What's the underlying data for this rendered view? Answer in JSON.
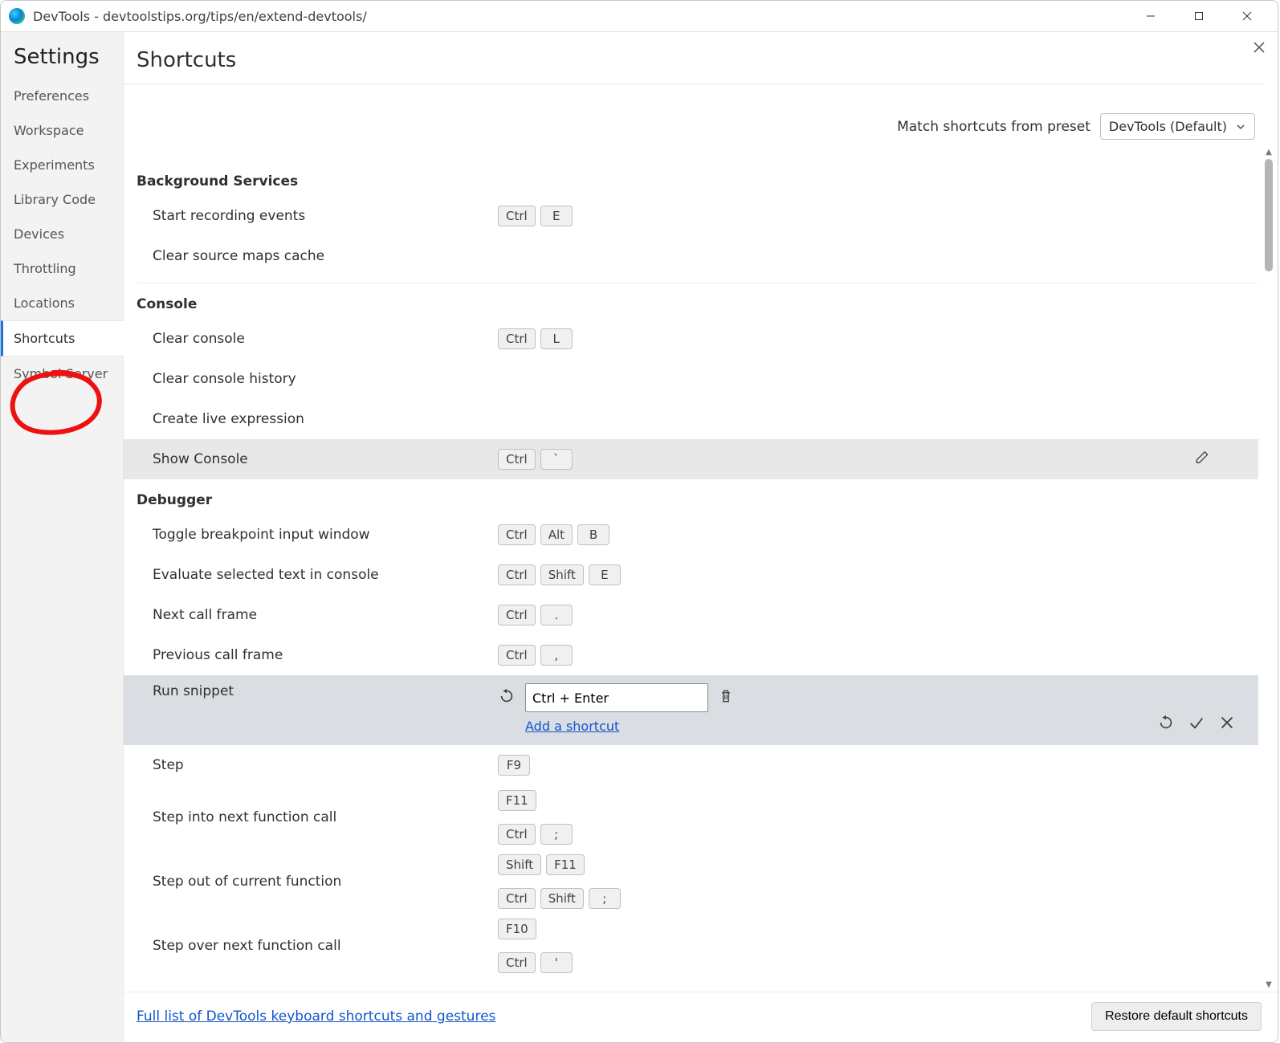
{
  "window": {
    "title": "DevTools - devtoolstips.org/tips/en/extend-devtools/"
  },
  "sidebar": {
    "title": "Settings",
    "items": [
      {
        "label": "Preferences",
        "selected": false
      },
      {
        "label": "Workspace",
        "selected": false
      },
      {
        "label": "Experiments",
        "selected": false
      },
      {
        "label": "Library Code",
        "selected": false
      },
      {
        "label": "Devices",
        "selected": false
      },
      {
        "label": "Throttling",
        "selected": false
      },
      {
        "label": "Locations",
        "selected": false
      },
      {
        "label": "Shortcuts",
        "selected": true
      },
      {
        "label": "Symbol Server",
        "selected": false
      }
    ]
  },
  "page": {
    "title": "Shortcuts",
    "preset_label": "Match shortcuts from preset",
    "preset_value": "DevTools (Default)"
  },
  "categories": [
    {
      "name": "Background Services",
      "rows": [
        {
          "label": "Start recording events",
          "keys": [
            [
              "Ctrl",
              "E"
            ]
          ]
        },
        {
          "label": "Clear source maps cache",
          "keys": []
        }
      ]
    },
    {
      "name": "Console",
      "rows": [
        {
          "label": "Clear console",
          "keys": [
            [
              "Ctrl",
              "L"
            ]
          ]
        },
        {
          "label": "Clear console history",
          "keys": []
        },
        {
          "label": "Create live expression",
          "keys": []
        },
        {
          "label": "Show Console",
          "keys": [
            [
              "Ctrl",
              "`"
            ]
          ],
          "hovered": true
        }
      ]
    },
    {
      "name": "Debugger",
      "rows": [
        {
          "label": "Toggle breakpoint input window",
          "keys": [
            [
              "Ctrl",
              "Alt",
              "B"
            ]
          ]
        },
        {
          "label": "Evaluate selected text in console",
          "keys": [
            [
              "Ctrl",
              "Shift",
              "E"
            ]
          ]
        },
        {
          "label": "Next call frame",
          "keys": [
            [
              "Ctrl",
              "."
            ]
          ]
        },
        {
          "label": "Previous call frame",
          "keys": [
            [
              "Ctrl",
              ","
            ]
          ]
        },
        {
          "label": "Run snippet",
          "editing": true,
          "input_value": "Ctrl + Enter",
          "add_link": "Add a shortcut"
        },
        {
          "label": "Step",
          "keys": [
            [
              "F9"
            ]
          ]
        },
        {
          "label": "Step into next function call",
          "keys": [
            [
              "F11"
            ],
            [
              "Ctrl",
              ";"
            ]
          ]
        },
        {
          "label": "Step out of current function",
          "keys": [
            [
              "Shift",
              "F11"
            ],
            [
              "Ctrl",
              "Shift",
              ";"
            ]
          ]
        },
        {
          "label": "Step over next function call",
          "keys": [
            [
              "F10"
            ],
            [
              "Ctrl",
              "'"
            ]
          ]
        }
      ]
    }
  ],
  "footer": {
    "link": "Full list of DevTools keyboard shortcuts and gestures",
    "button": "Restore default shortcuts"
  }
}
